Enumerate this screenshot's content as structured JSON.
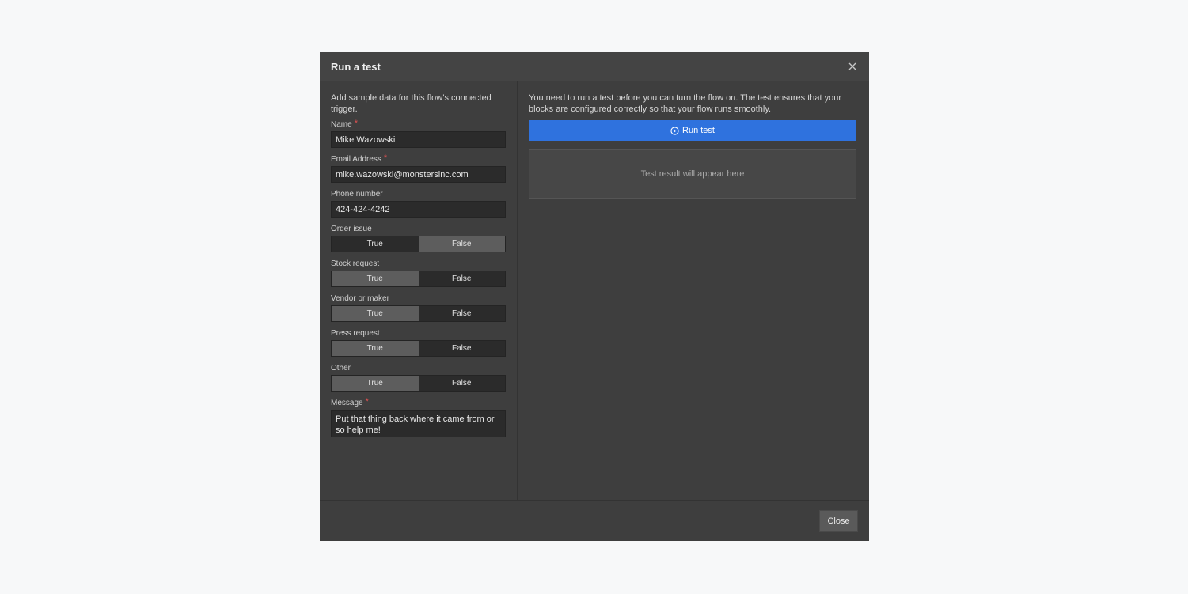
{
  "modal": {
    "title": "Run a test",
    "close_icon": "close-icon"
  },
  "form": {
    "intro": "Add sample data for this flow’s connected trigger.",
    "required_marker": "*",
    "name": {
      "label": "Name",
      "value": "Mike Wazowski"
    },
    "email": {
      "label": "Email Address",
      "value": "mike.wazowski@monstersinc.com"
    },
    "phone": {
      "label": "Phone number",
      "value": "424-424-4242"
    },
    "order_issue": {
      "label": "Order issue",
      "true_label": "True",
      "false_label": "False",
      "selected": "False"
    },
    "stock_request": {
      "label": "Stock request",
      "true_label": "True",
      "false_label": "False",
      "selected": "True"
    },
    "vendor_or_maker": {
      "label": "Vendor or maker",
      "true_label": "True",
      "false_label": "False",
      "selected": "True"
    },
    "press_request": {
      "label": "Press request",
      "true_label": "True",
      "false_label": "False",
      "selected": "True"
    },
    "other": {
      "label": "Other",
      "true_label": "True",
      "false_label": "False",
      "selected": "True"
    },
    "message": {
      "label": "Message",
      "value": "Put that thing back where it came from or so help me!"
    }
  },
  "right": {
    "info": "You need to run a test before you can turn the flow on. The test ensures that your blocks are configured correctly so that your flow runs smoothly.",
    "run_button": "Run test",
    "run_icon": "play-circle-icon",
    "result_placeholder": "Test result will appear here"
  },
  "footer": {
    "close_label": "Close"
  },
  "colors": {
    "primary": "#2f72de",
    "required": "#e05252",
    "toggle_active": "#5d5d5d"
  }
}
